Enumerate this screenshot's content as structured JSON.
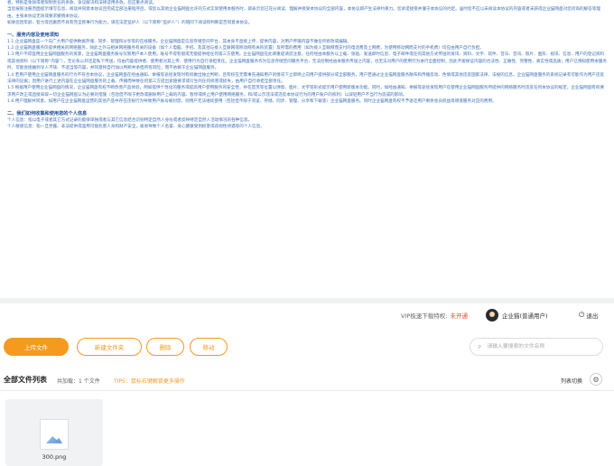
{
  "document": {
    "paragraphs": [
      {
        "type": "p",
        "text": "者，特别是免除或者限制责任的条款、争议解决和法律适用条款。您应重点阅读。"
      },
      {
        "type": "p",
        "text": "当您按照注册页面提示填写信息、阅读并同意本协议且完成全部注册程序后，或您以其他企业猫网盘允许的方式实际使用本服务时，即表示您已充分阅读、理解并接受本协议的全部内容，本协议即产生法律约束力。您承诺接受并遵守本协议的约定。届时您不应以未阅读本协议的内容或者未获得企业猫网盘对您问询的解答等理由，主张本协议无效或要求撤销本协议。"
      },
      {
        "type": "p",
        "text": "如果您因年龄、智力等因素而不具有完全民事行为能力，请在法定监护人（以下简称“监护人”）的陪同下阅读和判断是否同意本协议。"
      },
      {
        "type": "sec",
        "text": "一、服务内容及使用须知"
      },
      {
        "type": "p",
        "text": "1.1 企业猫网盘是一个向广大用户提供数据存储、同步、管理和分享等的在线服务。企业猫网盘是信息存储空间平台，其本身不直接上传、提供内容，对用户传输内容不做任何修改或编辑。"
      },
      {
        "type": "p",
        "text": "1.2 企业猫网盘服务仅提供相关的网络服务，除此之外与相关网络服务有关的设备（如个人电脑、手机、及其他与接入互联网或移动网有关的装置）及所需的费用（如为接入互联网而支付的电话费及上网费，为使用移动网而支付的手机费）均应由用户自行负担。"
      },
      {
        "type": "p",
        "text": "1.3 用户不得滥用企业猫网盘服务的资源，企业猫网盘服务账号仅限用户本人使用。账号不得有偿或无偿提供给任何第三方使用。企业猫网盘在此郑重提请您注意，任何经由本服务以上载、张贴、发送即时信息、电子邮件或任何其他方式传送的资讯、资料、文字、软件、音乐、音讯、照片、图形、视讯、信息、用户的登记资料或其他资料（以下简称“内容”），无论系公开还是私下传送，均由内容提供者、使用者对其上传、使用行为自行承担责任。企业猫网盘服务作为信息存储空间服务平台，无法控制经由本服务传送之内容，也无法对用户的使用行为进行全面控制，因此不能保证内容的合法性、正确性、完整性、真实性或品质；用户已预知使用本服务时，可能会接触到令人不快、不适当等内容，并同意将自行加以判断并承担所有风险，而不依赖于企业猫网盘服务。"
      },
      {
        "type": "p",
        "text": "1.4 若用户使用企业猫网盘服务的行为不符合本协议，企业猫网盘在经由通知、举报等途径发现时有权做出独立判断，且有权在无需事先通知用户的情况下立即终止向用户提供部分或全部服务。用户若通过企业猫网盘服务散布和传播反动、色情或其他违反国家法律、法规的信息，企业猫网盘服务的系统记录有可能作为用户违反法律的证据；因用户进行上述内容在企业猫网盘服务的上载、传播而导致任何第三方提出索赔要求或衍生的任何损害或损失，由用户自行承担全部责任。"
      },
      {
        "type": "p",
        "text": "1.5 根据用户使用企业猫网盘的情况，企业猫网盘有权不断改善产品体验，例如提供个性化的服务或提高用户使用服务的安全性，并在首页等位置以弹窗、图片、文字等形式提示用户使用新版本功能。同时，如经由通知、举报等途径发现用户在使用企业猫网盘服务所提供的网络服务时违反任何本协议的规定，企业猫网盘有权要求用户改正或直接采取一切企业猫网盘认为必要的措施（包括但不限于更改或删除用户上载的内容、暂停或终止用户使用网络服务，和/或公示违法或违反本协议行为的用户账户的权利）以减轻用户不当行为造成的影响。"
      },
      {
        "type": "p",
        "text": "1.6 用户理解并同意，如用户在企业猫网盘运营的其他产品中存在违规行为导致用户账号被封禁，则用户无法继续使用（包括但不限于浏览、存储、同步、管理、分享和下载等）企业猫网盘服务。同时企业猫网盘有权不予退还用户剩余会员权益等增值服务对应的费用。"
      },
      {
        "type": "sec",
        "text": "二、我们如何收集和使用您的个人信息"
      },
      {
        "type": "p",
        "text": "个人信息：指以电子或者其它方式记录的能够单独或者与其它信息结合识别特定自然人身份或者反映特定自然人活动情况的各种信息。"
      },
      {
        "type": "p",
        "text": "个人敏感信息：指一旦泄露、非法提供或滥用可能危害人身和财产安全，极易导致个人名誉、身心健康受到损害或歧视性待遇等的个人信息。"
      }
    ]
  },
  "header": {
    "vip_label": "VIP极速下载特权:",
    "vip_status": "未开通",
    "user_name": "企业猫(普通用户)",
    "logout_label": "退出"
  },
  "toolbar": {
    "upload_label": "上传文件",
    "new_folder_label": "新建文件夹",
    "delete_label": "删除",
    "move_label": "移动"
  },
  "search": {
    "placeholder": "请输入要搜索的文件名称"
  },
  "file_list": {
    "title": "全部文件列表",
    "count_text": "共加载：1 个文件",
    "tips": "TIPS：鼠标右键解锁更多操作",
    "view_switch_label": "列表切换",
    "files": [
      {
        "name": "300.png"
      }
    ]
  },
  "colors": {
    "accent": "#f59a1f",
    "status_red": "#e8482c",
    "doc_text": "#3a6fb6"
  }
}
